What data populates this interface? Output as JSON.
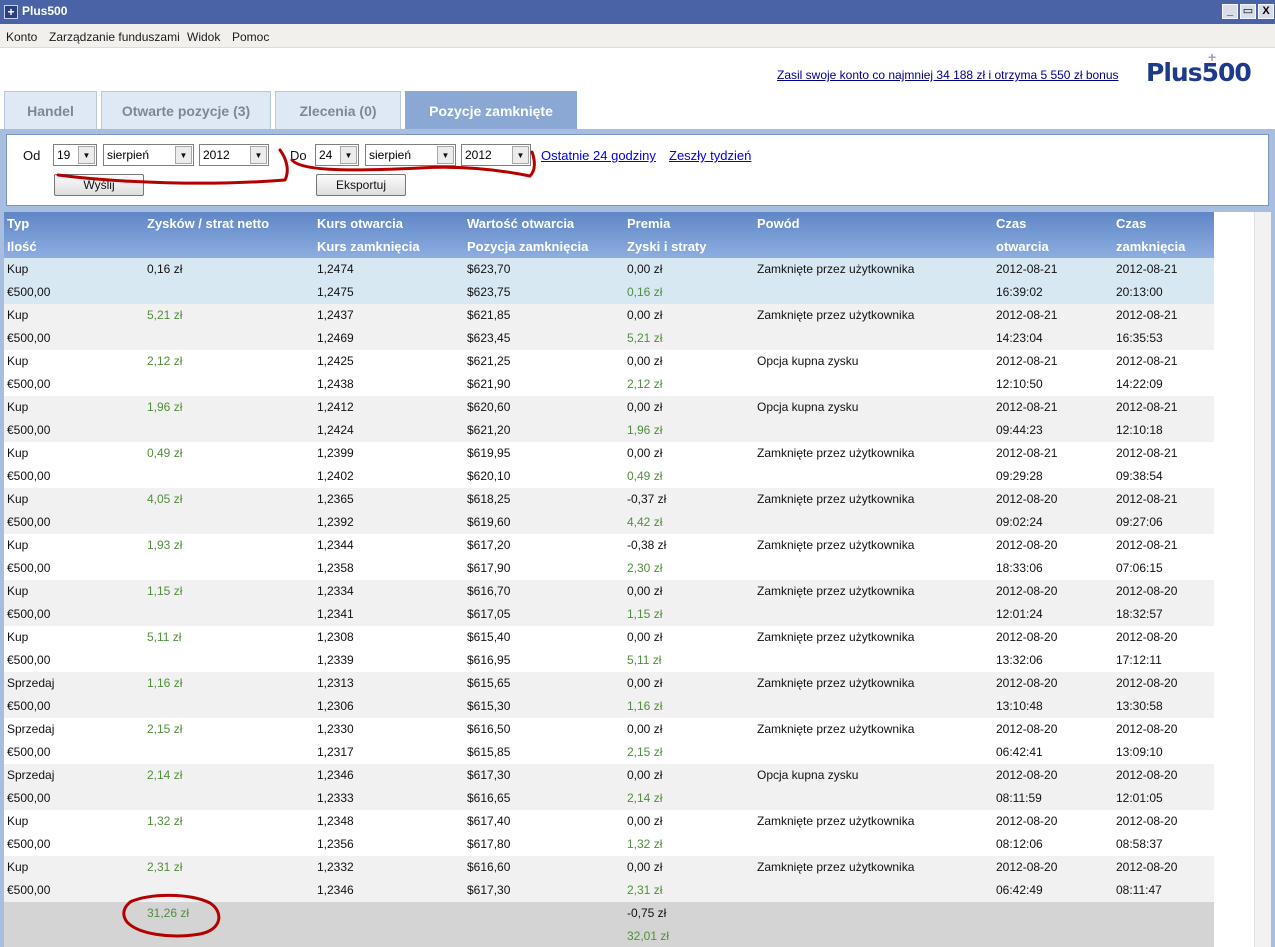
{
  "window": {
    "app_icon": "+",
    "title": "Plus500",
    "minimize": "_",
    "restore": "▭",
    "close": "X"
  },
  "menu": [
    "Konto",
    "Zarządzanie funduszami",
    "Widok",
    "Pomoc"
  ],
  "promo": "Zasil swoje konto co najmniej 34 188 zł i otrzyma 5 550 zł bonus",
  "logo": {
    "text": "Plus500",
    "mark": "+"
  },
  "tabs": [
    "Handel",
    "Otwarte pozycje (3)",
    "Zlecenia (0)",
    "Pozycje zamknięte"
  ],
  "filter": {
    "from_label": "Od",
    "from_day": "19",
    "from_month": "sierpień",
    "from_year": "2012",
    "to_label": "Do",
    "to_day": "24",
    "to_month": "sierpień",
    "to_year": "2012",
    "last24": "Ostatnie 24 godziny",
    "last_week": "Zeszły tydzień",
    "send": "Wyślij",
    "export": "Eksportuj"
  },
  "table": {
    "headers": [
      [
        "Typ",
        "Ilość"
      ],
      [
        "Zysków / strat netto",
        ""
      ],
      [
        "Kurs otwarcia",
        "Kurs zamknięcia"
      ],
      [
        "Wartość otwarcia",
        "Pozycja zamknięcia"
      ],
      [
        "Premia",
        "Zyski i straty"
      ],
      [
        "Powód",
        ""
      ],
      [
        "Czas",
        "otwarcia"
      ],
      [
        "Czas",
        "zamknięcia"
      ]
    ],
    "rows": [
      {
        "type": "Kup",
        "qty": "€500,00",
        "net": "0,16 zł",
        "open_rate": "1,2474",
        "close_rate": "1,2475",
        "open_value": "$623,70",
        "close_value": "$623,75",
        "premium": "0,00 zł",
        "pl": "0,16 zł",
        "reason": "Zamknięte przez użytkownika",
        "open_date": "2012-08-21",
        "open_time": "16:39:02",
        "close_date": "2012-08-21",
        "close_time": "20:13:00"
      },
      {
        "type": "Kup",
        "qty": "€500,00",
        "net": "5,21 zł",
        "open_rate": "1,2437",
        "close_rate": "1,2469",
        "open_value": "$621,85",
        "close_value": "$623,45",
        "premium": "0,00 zł",
        "pl": "5,21 zł",
        "reason": "Zamknięte przez użytkownika",
        "open_date": "2012-08-21",
        "open_time": "14:23:04",
        "close_date": "2012-08-21",
        "close_time": "16:35:53"
      },
      {
        "type": "Kup",
        "qty": "€500,00",
        "net": "2,12 zł",
        "open_rate": "1,2425",
        "close_rate": "1,2438",
        "open_value": "$621,25",
        "close_value": "$621,90",
        "premium": "0,00 zł",
        "pl": "2,12 zł",
        "reason": "Opcja kupna zysku",
        "open_date": "2012-08-21",
        "open_time": "12:10:50",
        "close_date": "2012-08-21",
        "close_time": "14:22:09"
      },
      {
        "type": "Kup",
        "qty": "€500,00",
        "net": "1,96 zł",
        "open_rate": "1,2412",
        "close_rate": "1,2424",
        "open_value": "$620,60",
        "close_value": "$621,20",
        "premium": "0,00 zł",
        "pl": "1,96 zł",
        "reason": "Opcja kupna zysku",
        "open_date": "2012-08-21",
        "open_time": "09:44:23",
        "close_date": "2012-08-21",
        "close_time": "12:10:18"
      },
      {
        "type": "Kup",
        "qty": "€500,00",
        "net": "0,49 zł",
        "open_rate": "1,2399",
        "close_rate": "1,2402",
        "open_value": "$619,95",
        "close_value": "$620,10",
        "premium": "0,00 zł",
        "pl": "0,49 zł",
        "reason": "Zamknięte przez użytkownika",
        "open_date": "2012-08-21",
        "open_time": "09:29:28",
        "close_date": "2012-08-21",
        "close_time": "09:38:54"
      },
      {
        "type": "Kup",
        "qty": "€500,00",
        "net": "4,05 zł",
        "open_rate": "1,2365",
        "close_rate": "1,2392",
        "open_value": "$618,25",
        "close_value": "$619,60",
        "premium": "-0,37 zł",
        "pl": "4,42 zł",
        "reason": "Zamknięte przez użytkownika",
        "open_date": "2012-08-20",
        "open_time": "09:02:24",
        "close_date": "2012-08-21",
        "close_time": "09:27:06"
      },
      {
        "type": "Kup",
        "qty": "€500,00",
        "net": "1,93 zł",
        "open_rate": "1,2344",
        "close_rate": "1,2358",
        "open_value": "$617,20",
        "close_value": "$617,90",
        "premium": "-0,38 zł",
        "pl": "2,30 zł",
        "reason": "Zamknięte przez użytkownika",
        "open_date": "2012-08-20",
        "open_time": "18:33:06",
        "close_date": "2012-08-21",
        "close_time": "07:06:15"
      },
      {
        "type": "Kup",
        "qty": "€500,00",
        "net": "1,15 zł",
        "open_rate": "1,2334",
        "close_rate": "1,2341",
        "open_value": "$616,70",
        "close_value": "$617,05",
        "premium": "0,00 zł",
        "pl": "1,15 zł",
        "reason": "Zamknięte przez użytkownika",
        "open_date": "2012-08-20",
        "open_time": "12:01:24",
        "close_date": "2012-08-20",
        "close_time": "18:32:57"
      },
      {
        "type": "Kup",
        "qty": "€500,00",
        "net": "5,11 zł",
        "open_rate": "1,2308",
        "close_rate": "1,2339",
        "open_value": "$615,40",
        "close_value": "$616,95",
        "premium": "0,00 zł",
        "pl": "5,11 zł",
        "reason": "Zamknięte przez użytkownika",
        "open_date": "2012-08-20",
        "open_time": "13:32:06",
        "close_date": "2012-08-20",
        "close_time": "17:12:11"
      },
      {
        "type": "Sprzedaj",
        "qty": "€500,00",
        "net": "1,16 zł",
        "open_rate": "1,2313",
        "close_rate": "1,2306",
        "open_value": "$615,65",
        "close_value": "$615,30",
        "premium": "0,00 zł",
        "pl": "1,16 zł",
        "reason": "Zamknięte przez użytkownika",
        "open_date": "2012-08-20",
        "open_time": "13:10:48",
        "close_date": "2012-08-20",
        "close_time": "13:30:58"
      },
      {
        "type": "Sprzedaj",
        "qty": "€500,00",
        "net": "2,15 zł",
        "open_rate": "1,2330",
        "close_rate": "1,2317",
        "open_value": "$616,50",
        "close_value": "$615,85",
        "premium": "0,00 zł",
        "pl": "2,15 zł",
        "reason": "Zamknięte przez użytkownika",
        "open_date": "2012-08-20",
        "open_time": "06:42:41",
        "close_date": "2012-08-20",
        "close_time": "13:09:10"
      },
      {
        "type": "Sprzedaj",
        "qty": "€500,00",
        "net": "2,14 zł",
        "open_rate": "1,2346",
        "close_rate": "1,2333",
        "open_value": "$617,30",
        "close_value": "$616,65",
        "premium": "0,00 zł",
        "pl": "2,14 zł",
        "reason": "Opcja kupna zysku",
        "open_date": "2012-08-20",
        "open_time": "08:11:59",
        "close_date": "2012-08-20",
        "close_time": "12:01:05"
      },
      {
        "type": "Kup",
        "qty": "€500,00",
        "net": "1,32 zł",
        "open_rate": "1,2348",
        "close_rate": "1,2356",
        "open_value": "$617,40",
        "close_value": "$617,80",
        "premium": "0,00 zł",
        "pl": "1,32 zł",
        "reason": "Zamknięte przez użytkownika",
        "open_date": "2012-08-20",
        "open_time": "08:12:06",
        "close_date": "2012-08-20",
        "close_time": "08:58:37"
      },
      {
        "type": "Kup",
        "qty": "€500,00",
        "net": "2,31 zł",
        "open_rate": "1,2332",
        "close_rate": "1,2346",
        "open_value": "$616,60",
        "close_value": "$617,30",
        "premium": "0,00 zł",
        "pl": "2,31 zł",
        "reason": "Zamknięte przez użytkownika",
        "open_date": "2012-08-20",
        "open_time": "06:42:49",
        "close_date": "2012-08-20",
        "close_time": "08:11:47"
      }
    ],
    "totals": {
      "net": "31,26 zł",
      "premium": "-0,75 zł",
      "pl": "32,01 zł"
    },
    "selected_row": 0
  },
  "colors": {
    "titlebar": "#4a63a6",
    "tab_active": "#8aa8d3",
    "header": "#6d93d0",
    "profit": "#4f8f3c",
    "annotation": "#b50000"
  }
}
